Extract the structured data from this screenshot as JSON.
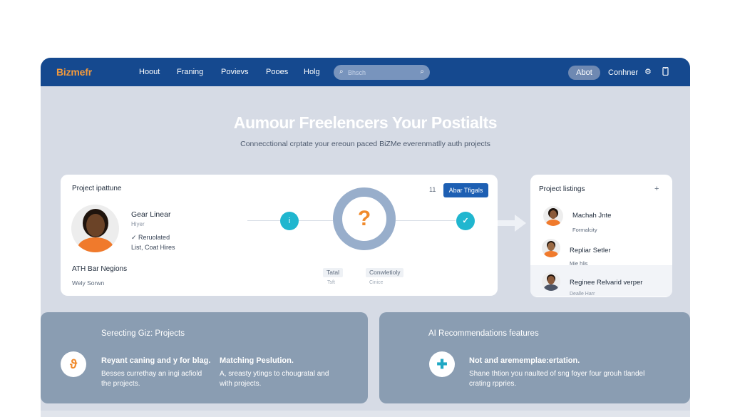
{
  "nav": {
    "logo": "Bizmefr",
    "links": [
      "Hoout",
      "Franing",
      "Povievs",
      "Pooes",
      "Holg"
    ],
    "search_placeholder": "Bhsch",
    "about_label": "Abot",
    "contact_label": "Conhner",
    "icons": [
      "settings-icon",
      "phone-icon"
    ]
  },
  "hero": {
    "title": "Aumour Freelencers Your Postialts",
    "subtitle": "Connecctional crptate your ereoun paced BiZMe everenmatlly auth projects"
  },
  "project_card": {
    "title": "Project ipattune",
    "person_name": "Gear Linear",
    "person_role": "Hiyer",
    "check_text": "✓ Reruolated",
    "detail_text": "List, Coat Hires",
    "footer_title": "ATH Bar Negions",
    "footer_sub": "Wely Sorwn",
    "node_left_glyph": "i",
    "ring_glyph": "?",
    "node_right_glyph": "✓",
    "counter": "11",
    "apply_label": "Abar Tfigals",
    "pill_left": "Tatal",
    "pill_left_sub": "Tsft",
    "pill_right": "Conwletioly",
    "pill_right_sub": "Cinice",
    "accent_orange": "#f08a2c",
    "accent_teal": "#20b6cf",
    "accent_blue": "#1d5fb3"
  },
  "listings": {
    "title": "Project listings",
    "add_glyph": "+",
    "items": [
      {
        "name": "Machah Jnte",
        "sub": "Formalcity"
      },
      {
        "name": "Repliar Setler",
        "sub": "Mie hlis"
      },
      {
        "name": "Reginee Relvarid verper",
        "sub": "Dealle Harr"
      }
    ]
  },
  "features": {
    "left": {
      "title": "Serecting Giz: Projects",
      "icon": "link-icon",
      "col1_heading": "Reyant caning and y for blag.",
      "col1_body": [
        "Besses currethay an ingi acfiold",
        "the projects."
      ],
      "col2_heading": "Matching Peslution.",
      "col2_body": [
        "A, sreasty ytings to chougratal and",
        "with projects."
      ]
    },
    "right": {
      "title": "AI Recommendations features",
      "icon": "plus-cross-icon",
      "heading": "Not and arememplae:ertation.",
      "body": [
        "Shane thtion you naulted of sng foyer four grouh tlandel",
        "crating rppries."
      ]
    }
  },
  "colors": {
    "navbar": "#15498f",
    "logo": "#f39a3c",
    "background": "#d6dbe5",
    "feature_card": "#8a9db2"
  }
}
